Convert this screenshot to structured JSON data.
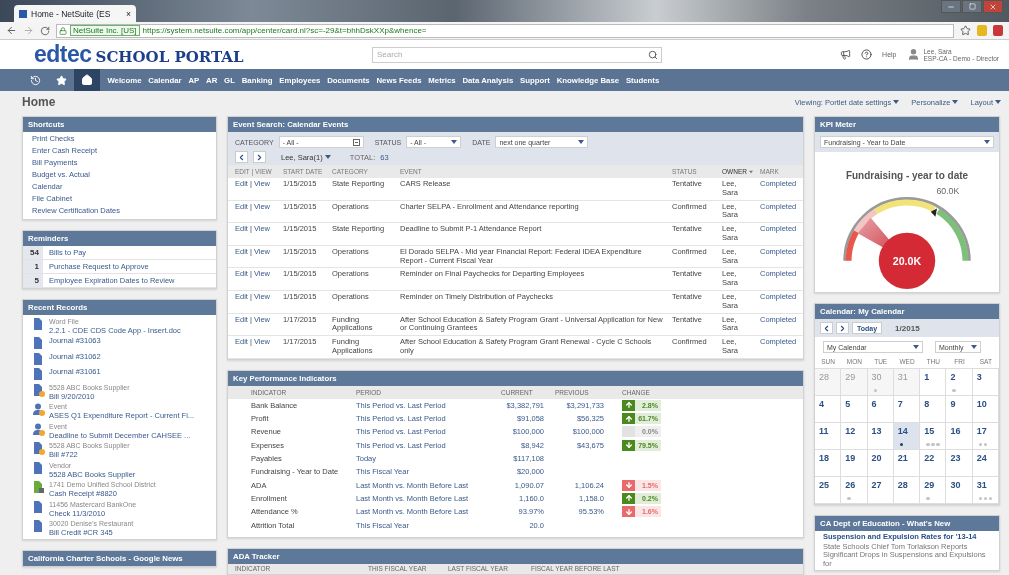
{
  "browser": {
    "tab_title": "Home - NetSuite (ES",
    "tab_close": "×",
    "site_identity": "NetSuite Inc. [US]",
    "url": "https://system.netsuite.com/app/center/card.nl?sc=-29&t=bhhDskXXp&whence="
  },
  "header": {
    "logo_main": "edtec",
    "logo_sub": "SCHOOL PORTAL",
    "search": {
      "placeholder": "Search"
    },
    "help": "Help",
    "user_name": "Lee, Sara",
    "user_role": "ESP-CA - Demo - Director"
  },
  "nav": {
    "icon_tabs": [
      {
        "kind": "recent",
        "selected": false
      },
      {
        "kind": "favorites",
        "selected": false
      },
      {
        "kind": "home",
        "selected": true
      }
    ],
    "items": [
      "Welcome",
      "Calendar",
      "AP",
      "AR",
      "GL",
      "Banking",
      "Employees",
      "Documents",
      "News Feeds",
      "Metrics",
      "Data Analysis",
      "Support",
      "Knowledge Base",
      "Students"
    ]
  },
  "page": {
    "title": "Home",
    "links": [
      "Viewing: Portlet date settings",
      "Personalize",
      "Layout"
    ]
  },
  "shortcuts": {
    "title": "Shortcuts",
    "items": [
      "Print Checks",
      "Enter Cash Receipt",
      "Bill Payments",
      "Budget vs. Actual",
      "Calendar",
      "File Cabinet",
      "Review Certification Dates"
    ]
  },
  "reminders": {
    "title": "Reminders",
    "items": [
      {
        "count": "54",
        "label": "Bills to Pay"
      },
      {
        "count": "1",
        "label": "Purchase Request to Approve"
      },
      {
        "count": "5",
        "label": "Employee Expiration Dates to Review"
      }
    ]
  },
  "recent_records": {
    "title": "Recent Records",
    "items": [
      {
        "kind": "doc",
        "type": "Word File",
        "name": "2.2.1 - CDE CDS Code App - Insert.doc"
      },
      {
        "kind": "doc",
        "name": "Journal #31063"
      },
      {
        "kind": "doc",
        "name": "Journal #31062"
      },
      {
        "kind": "doc",
        "name": "Journal #31061"
      },
      {
        "kind": "bill",
        "type": "5528 ABC Books Supplier",
        "name": "Bill 9/20/2010"
      },
      {
        "kind": "event",
        "type": "Event",
        "name": "ASES Q1 Expenditure Report - Current Fi..."
      },
      {
        "kind": "event",
        "type": "Event",
        "name": "Deadline to Submit December CAHSEE ..."
      },
      {
        "kind": "bill",
        "type": "5528 ABC Books Supplier",
        "name": "Bill #722"
      },
      {
        "kind": "doc",
        "type": "Vendor",
        "name": "5528 ABC Books Supplier"
      },
      {
        "kind": "receipt",
        "type": "1741 Demo Unified School District",
        "name": "Cash Receipt #8820"
      },
      {
        "kind": "doc",
        "type": "11456 Mastercard BankOne",
        "name": "Check 11/3/2010"
      },
      {
        "kind": "doc",
        "type": "30020 Denise's Restaurant",
        "name": "Bill Credit #CR 345"
      }
    ]
  },
  "google_news": {
    "title": "California Charter Schools - Google News"
  },
  "event_search": {
    "title": "Event Search: Calendar Events",
    "filters": [
      {
        "label": "CATEGORY",
        "value": "- All -",
        "kind": "picker"
      },
      {
        "label": "STATUS",
        "value": "- All -",
        "kind": "dropdown"
      },
      {
        "label": "DATE",
        "value": "next one quarter",
        "kind": "dropdown"
      }
    ],
    "owner_filter": "Lee, Sara(1)",
    "total_label": "TOTAL:",
    "total": "63",
    "columns": [
      {
        "label": "EDIT | VIEW",
        "sorted": false
      },
      {
        "label": "START DATE",
        "sorted": false
      },
      {
        "label": "CATEGORY",
        "sorted": false
      },
      {
        "label": "EVENT",
        "sorted": false
      },
      {
        "label": "STATUS",
        "sorted": false
      },
      {
        "label": "OWNER",
        "sorted": true
      },
      {
        "label": "MARK",
        "sorted": false
      }
    ],
    "rows": [
      {
        "edit": "Edit",
        "sep": "|",
        "view": "View",
        "start_date": "1/15/2015",
        "category": "State Reporting",
        "event": "CARS Release",
        "status": "Tentative",
        "owner": "Lee, Sara",
        "mark": "Completed"
      },
      {
        "edit": "Edit",
        "sep": "|",
        "view": "View",
        "start_date": "1/15/2015",
        "category": "Operations",
        "event": "Charter SELPA - Enrollment and Attendance reporting",
        "status": "Confirmed",
        "owner": "Lee, Sara",
        "mark": "Completed"
      },
      {
        "edit": "Edit",
        "sep": "|",
        "view": "View",
        "start_date": "1/15/2015",
        "category": "State Reporting",
        "event": "Deadline to Submit P-1 Attendance Report",
        "status": "Tentative",
        "owner": "Lee, Sara",
        "mark": "Completed"
      },
      {
        "edit": "Edit",
        "sep": "|",
        "view": "View",
        "start_date": "1/15/2015",
        "category": "Operations",
        "event": "El Dorado SELPA - Mid year Financial Report: Federal IDEA Expenditure Report - Current Fiscal Year",
        "status": "Confirmed",
        "owner": "Lee, Sara",
        "mark": "Completed"
      },
      {
        "edit": "Edit",
        "sep": "|",
        "view": "View",
        "start_date": "1/15/2015",
        "category": "Operations",
        "event": "Reminder on Final Paychecks for Departing Employees",
        "status": "Tentative",
        "owner": "Lee, Sara",
        "mark": "Completed"
      },
      {
        "edit": "Edit",
        "sep": "|",
        "view": "View",
        "start_date": "1/15/2015",
        "category": "Operations",
        "event": "Reminder on Timely Distribution of Paychecks",
        "status": "Tentative",
        "owner": "Lee, Sara",
        "mark": "Completed"
      },
      {
        "edit": "Edit",
        "sep": "|",
        "view": "View",
        "start_date": "1/17/2015",
        "category": "Funding Applications",
        "event": "After School Education & Safety Program Grant - Universal Application for New or Continuing Grantees",
        "status": "Tentative",
        "owner": "Lee, Sara",
        "mark": "Completed"
      },
      {
        "edit": "Edit",
        "sep": "|",
        "view": "View",
        "start_date": "1/17/2015",
        "category": "Funding Applications",
        "event": "After School Education & Safety Program Grant Renewal - Cycle C Schools only",
        "status": "Confirmed",
        "owner": "Lee, Sara",
        "mark": "Completed"
      }
    ]
  },
  "kpi": {
    "title": "Key Performance Indicators",
    "columns": [
      "INDICATOR",
      "PERIOD",
      "CURRENT",
      "PREVIOUS",
      "CHANGE"
    ],
    "rows": [
      {
        "indicator": "Bank Balance",
        "period": "This Period vs. Last Period",
        "current": "$3,382,791",
        "previous": "$3,291,733",
        "change": "2.8%",
        "kind": "up",
        "color": "#4b8a1d"
      },
      {
        "indicator": "Profit",
        "period": "This Period vs. Last Period",
        "current": "$91,058",
        "previous": "$56,325",
        "change": "61.7%",
        "kind": "up",
        "color": "#4b8a1d"
      },
      {
        "indicator": "Revenue",
        "period": "This Period vs. Last Period",
        "current": "$100,000",
        "previous": "$100,000",
        "change": "0.0%",
        "kind": "flat",
        "color": "#e2e2e2"
      },
      {
        "indicator": "Expenses",
        "period": "This Period vs. Last Period",
        "current": "$8,942",
        "previous": "$43,675",
        "change": "79.5%",
        "kind": "down",
        "color": "#4b8a1d"
      },
      {
        "indicator": "Payables",
        "period": "Today",
        "current": "$117,108"
      },
      {
        "indicator": "Fundraising - Year to Date",
        "period": "This Fiscal Year",
        "current": "$20,000"
      },
      {
        "indicator": "ADA",
        "period": "Last Month vs. Month Before Last",
        "current": "1,090.07",
        "previous": "1,106.24",
        "change": "1.5%",
        "kind": "down",
        "color": "#e86a6a"
      },
      {
        "indicator": "Enrollment",
        "period": "Last Month vs. Month Before Last",
        "current": "1,160.0",
        "previous": "1,158.0",
        "change": "0.2%",
        "kind": "up",
        "color": "#4b8a1d"
      },
      {
        "indicator": "Attendance %",
        "period": "Last Month vs. Month Before Last",
        "current": "93.97%",
        "previous": "95.53%",
        "change": "1.6%",
        "kind": "down",
        "color": "#e86a6a"
      },
      {
        "indicator": "Attrition Total",
        "period": "This Fiscal Year",
        "current": "20.0"
      }
    ]
  },
  "ada_tracker": {
    "title": "ADA Tracker",
    "columns": [
      "INDICATOR",
      "THIS FISCAL YEAR",
      "LAST FISCAL YEAR",
      "FISCAL YEAR BEFORE LAST"
    ]
  },
  "kpi_meter": {
    "title": "KPI Meter",
    "selector": "Fundraising - Year to Date",
    "gauge_title": "Fundraising - year to date",
    "max_label": "60.0K",
    "value": "20.0K",
    "level": 0.22
  },
  "calendar": {
    "title": "Calendar: My Calendar",
    "today_button": "Today",
    "month": "1/2015",
    "calendar_select": "My Calendar",
    "view_select": "Monthly",
    "weekdays": [
      "SUN",
      "MON",
      "TUE",
      "WED",
      "THU",
      "FRI",
      "SAT"
    ],
    "days": [
      {
        "day": "28",
        "muted": true,
        "selected": false
      },
      {
        "day": "29",
        "muted": true,
        "selected": false
      },
      {
        "day": "30",
        "muted": true,
        "selected": false,
        "dots": [
          {
            "kind": "faint"
          }
        ]
      },
      {
        "day": "31",
        "muted": true,
        "selected": false
      },
      {
        "day": "1",
        "muted": false,
        "selected": false
      },
      {
        "day": "2",
        "muted": false,
        "selected": false,
        "dots": [
          {
            "kind": "faint"
          }
        ]
      },
      {
        "day": "3",
        "muted": false,
        "selected": false
      },
      {
        "day": "4",
        "muted": false,
        "selected": false
      },
      {
        "day": "5",
        "muted": false,
        "selected": false
      },
      {
        "day": "6",
        "muted": false,
        "selected": false
      },
      {
        "day": "7",
        "muted": false,
        "selected": false
      },
      {
        "day": "8",
        "muted": false,
        "selected": false
      },
      {
        "day": "9",
        "muted": false,
        "selected": false
      },
      {
        "day": "10",
        "muted": false,
        "selected": false
      },
      {
        "day": "11",
        "muted": false,
        "selected": false
      },
      {
        "day": "12",
        "muted": false,
        "selected": false
      },
      {
        "day": "13",
        "muted": false,
        "selected": false
      },
      {
        "day": "14",
        "muted": false,
        "selected": true,
        "dots": [
          {
            "kind": "dark"
          }
        ]
      },
      {
        "day": "15",
        "muted": false,
        "selected": false,
        "dots": [
          {
            "kind": "faint"
          },
          {
            "kind": "faint"
          },
          {
            "kind": "faint"
          }
        ]
      },
      {
        "day": "16",
        "muted": false,
        "selected": false
      },
      {
        "day": "17",
        "muted": false,
        "selected": false,
        "dots": [
          {
            "kind": "faint"
          },
          {
            "kind": "faint"
          }
        ]
      },
      {
        "day": "18",
        "muted": false,
        "selected": false
      },
      {
        "day": "19",
        "muted": false,
        "selected": false
      },
      {
        "day": "20",
        "muted": false,
        "selected": false
      },
      {
        "day": "21",
        "muted": false,
        "selected": false
      },
      {
        "day": "22",
        "muted": false,
        "selected": false
      },
      {
        "day": "23",
        "muted": false,
        "selected": false
      },
      {
        "day": "24",
        "muted": false,
        "selected": false
      },
      {
        "day": "25",
        "muted": false,
        "selected": false
      },
      {
        "day": "26",
        "muted": false,
        "selected": false,
        "dots": [
          {
            "kind": "faint"
          }
        ]
      },
      {
        "day": "27",
        "muted": false,
        "selected": false
      },
      {
        "day": "28",
        "muted": false,
        "selected": false
      },
      {
        "day": "29",
        "muted": false,
        "selected": false,
        "dots": [
          {
            "kind": "faint"
          }
        ]
      },
      {
        "day": "30",
        "muted": false,
        "selected": false
      },
      {
        "day": "31",
        "muted": false,
        "selected": false,
        "dots": [
          {
            "kind": "faint"
          },
          {
            "kind": "faint"
          },
          {
            "kind": "faint"
          }
        ]
      }
    ]
  },
  "news": {
    "title": "CA Dept of Education - What's New",
    "headline": "Suspension and Expulsion Rates for '13-14",
    "summary": "State Schools Chief Tom Torlakson Reports Significant Drops in Suspensions and Expulsions for"
  }
}
